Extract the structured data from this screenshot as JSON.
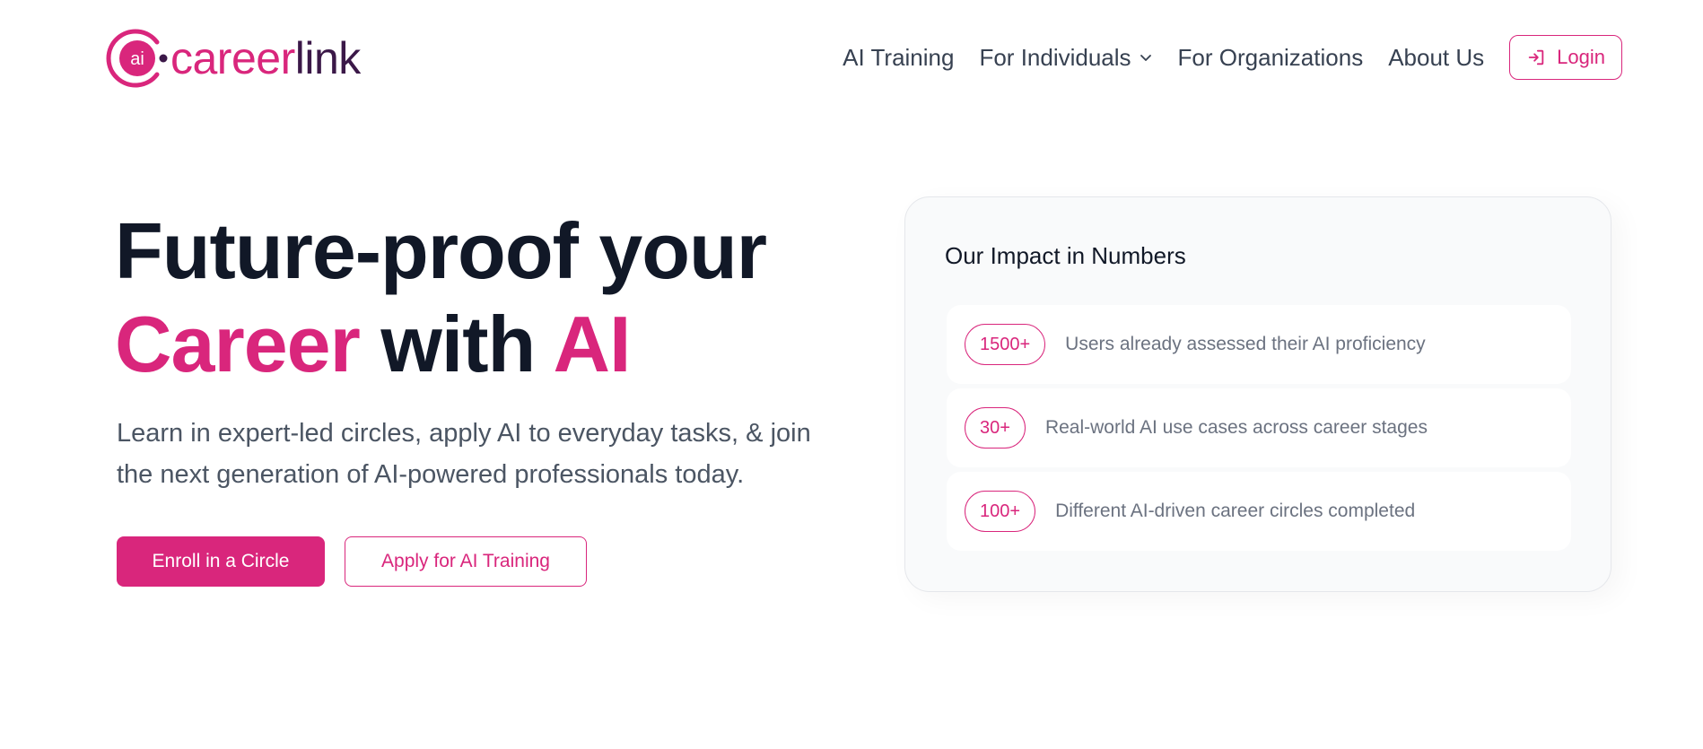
{
  "brand": {
    "logo_icon_text": "ai",
    "name_part1": "career",
    "name_part2": "link",
    "colors": {
      "primary": "#d9267c",
      "dark": "#3b1848",
      "heading": "#111827",
      "body": "#4b5563"
    }
  },
  "nav": {
    "items": [
      {
        "label": "AI Training"
      },
      {
        "label": "For Individuals",
        "has_dropdown": true
      },
      {
        "label": "For Organizations"
      },
      {
        "label": "About Us"
      }
    ],
    "login_label": "Login",
    "login_icon": "login-arrow-icon"
  },
  "hero": {
    "title_line1": "Future-proof your",
    "title_word_career": "Career",
    "title_word_with": "with",
    "title_word_ai": "AI",
    "subtitle": "Learn in expert-led circles, apply AI to everyday tasks, & join the next generation of AI-powered professionals today.",
    "primary_cta": "Enroll in a Circle",
    "secondary_cta": "Apply for AI Training"
  },
  "impact": {
    "title": "Our Impact in Numbers",
    "stats": [
      {
        "value": "1500+",
        "text": "Users already assessed their AI proficiency"
      },
      {
        "value": "30+",
        "text": "Real-world AI use cases across career stages"
      },
      {
        "value": "100+",
        "text": "Different AI-driven career circles completed"
      }
    ]
  }
}
